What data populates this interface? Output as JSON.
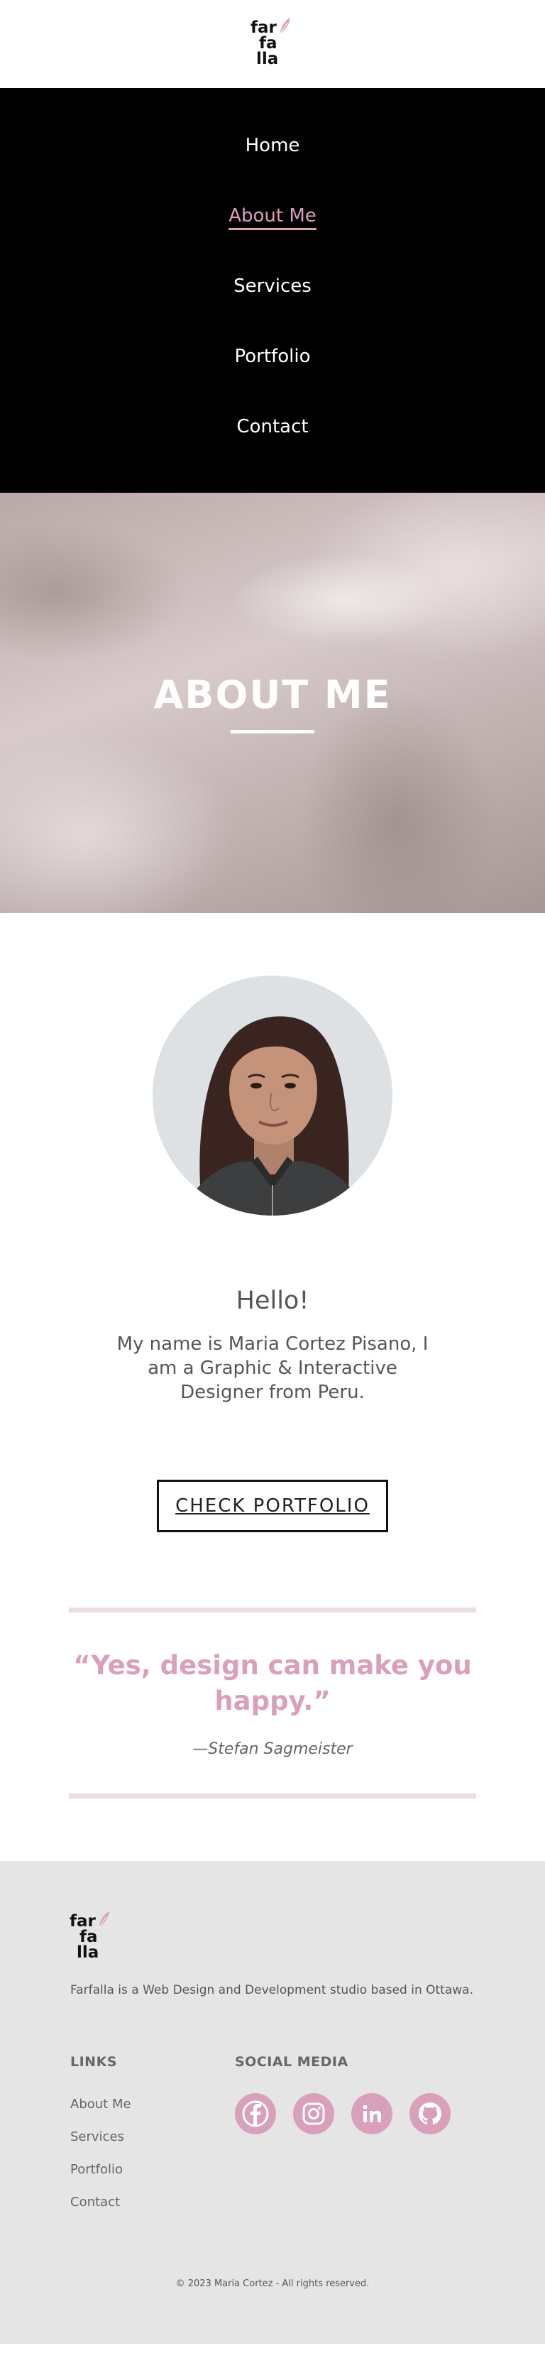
{
  "brand": {
    "logo_lines": [
      "far",
      "fa",
      "lla"
    ],
    "accent": "#d9a0bb"
  },
  "nav": {
    "items": [
      {
        "label": "Home",
        "active": false
      },
      {
        "label": "About Me",
        "active": true
      },
      {
        "label": "Services",
        "active": false
      },
      {
        "label": "Portfolio",
        "active": false
      },
      {
        "label": "Contact",
        "active": false
      }
    ]
  },
  "hero": {
    "title": "ABOUT ME"
  },
  "about": {
    "greeting": "Hello!",
    "intro": "My name is Maria Cortez Pisano, I am a Graphic & Interactive Designer from Peru.",
    "cta": "CHECK PORTFOLIO"
  },
  "quote": {
    "text": "“Yes, design can make you happy.”",
    "author": "—Stefan Sagmeister"
  },
  "footer": {
    "description": "Farfalla is a Web Design and Development studio based in Ottawa.",
    "links_title": "LINKS",
    "links": [
      "About Me",
      "Services",
      "Portfolio",
      "Contact"
    ],
    "social_title": "SOCIAL MEDIA",
    "social_icons": [
      "facebook-icon",
      "instagram-icon",
      "linkedin-icon",
      "github-icon"
    ],
    "copyright": "© 2023 Maria Cortez - All rights reserved."
  }
}
